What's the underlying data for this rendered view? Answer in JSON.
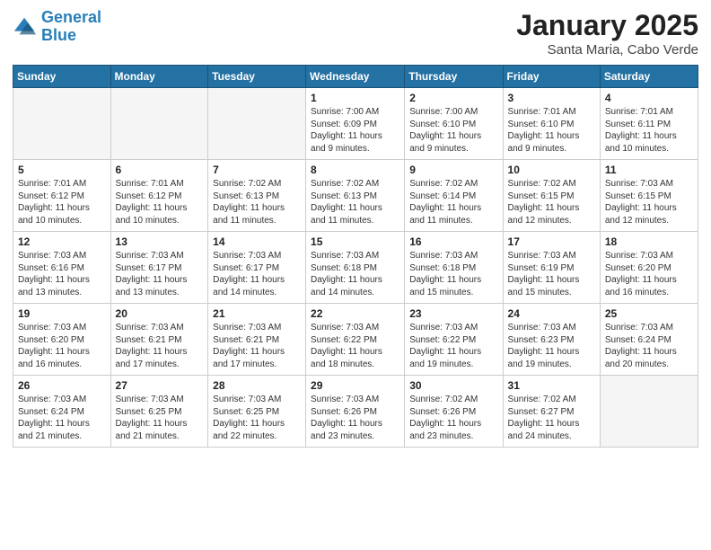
{
  "logo": {
    "line1": "General",
    "line2": "Blue"
  },
  "title": "January 2025",
  "subtitle": "Santa Maria, Cabo Verde",
  "days_header": [
    "Sunday",
    "Monday",
    "Tuesday",
    "Wednesday",
    "Thursday",
    "Friday",
    "Saturday"
  ],
  "weeks": [
    [
      {
        "num": "",
        "info": "",
        "empty": true
      },
      {
        "num": "",
        "info": "",
        "empty": true
      },
      {
        "num": "",
        "info": "",
        "empty": true
      },
      {
        "num": "1",
        "info": "Sunrise: 7:00 AM\nSunset: 6:09 PM\nDaylight: 11 hours\nand 9 minutes.",
        "empty": false
      },
      {
        "num": "2",
        "info": "Sunrise: 7:00 AM\nSunset: 6:10 PM\nDaylight: 11 hours\nand 9 minutes.",
        "empty": false
      },
      {
        "num": "3",
        "info": "Sunrise: 7:01 AM\nSunset: 6:10 PM\nDaylight: 11 hours\nand 9 minutes.",
        "empty": false
      },
      {
        "num": "4",
        "info": "Sunrise: 7:01 AM\nSunset: 6:11 PM\nDaylight: 11 hours\nand 10 minutes.",
        "empty": false
      }
    ],
    [
      {
        "num": "5",
        "info": "Sunrise: 7:01 AM\nSunset: 6:12 PM\nDaylight: 11 hours\nand 10 minutes.",
        "empty": false
      },
      {
        "num": "6",
        "info": "Sunrise: 7:01 AM\nSunset: 6:12 PM\nDaylight: 11 hours\nand 10 minutes.",
        "empty": false
      },
      {
        "num": "7",
        "info": "Sunrise: 7:02 AM\nSunset: 6:13 PM\nDaylight: 11 hours\nand 11 minutes.",
        "empty": false
      },
      {
        "num": "8",
        "info": "Sunrise: 7:02 AM\nSunset: 6:13 PM\nDaylight: 11 hours\nand 11 minutes.",
        "empty": false
      },
      {
        "num": "9",
        "info": "Sunrise: 7:02 AM\nSunset: 6:14 PM\nDaylight: 11 hours\nand 11 minutes.",
        "empty": false
      },
      {
        "num": "10",
        "info": "Sunrise: 7:02 AM\nSunset: 6:15 PM\nDaylight: 11 hours\nand 12 minutes.",
        "empty": false
      },
      {
        "num": "11",
        "info": "Sunrise: 7:03 AM\nSunset: 6:15 PM\nDaylight: 11 hours\nand 12 minutes.",
        "empty": false
      }
    ],
    [
      {
        "num": "12",
        "info": "Sunrise: 7:03 AM\nSunset: 6:16 PM\nDaylight: 11 hours\nand 13 minutes.",
        "empty": false
      },
      {
        "num": "13",
        "info": "Sunrise: 7:03 AM\nSunset: 6:17 PM\nDaylight: 11 hours\nand 13 minutes.",
        "empty": false
      },
      {
        "num": "14",
        "info": "Sunrise: 7:03 AM\nSunset: 6:17 PM\nDaylight: 11 hours\nand 14 minutes.",
        "empty": false
      },
      {
        "num": "15",
        "info": "Sunrise: 7:03 AM\nSunset: 6:18 PM\nDaylight: 11 hours\nand 14 minutes.",
        "empty": false
      },
      {
        "num": "16",
        "info": "Sunrise: 7:03 AM\nSunset: 6:18 PM\nDaylight: 11 hours\nand 15 minutes.",
        "empty": false
      },
      {
        "num": "17",
        "info": "Sunrise: 7:03 AM\nSunset: 6:19 PM\nDaylight: 11 hours\nand 15 minutes.",
        "empty": false
      },
      {
        "num": "18",
        "info": "Sunrise: 7:03 AM\nSunset: 6:20 PM\nDaylight: 11 hours\nand 16 minutes.",
        "empty": false
      }
    ],
    [
      {
        "num": "19",
        "info": "Sunrise: 7:03 AM\nSunset: 6:20 PM\nDaylight: 11 hours\nand 16 minutes.",
        "empty": false
      },
      {
        "num": "20",
        "info": "Sunrise: 7:03 AM\nSunset: 6:21 PM\nDaylight: 11 hours\nand 17 minutes.",
        "empty": false
      },
      {
        "num": "21",
        "info": "Sunrise: 7:03 AM\nSunset: 6:21 PM\nDaylight: 11 hours\nand 17 minutes.",
        "empty": false
      },
      {
        "num": "22",
        "info": "Sunrise: 7:03 AM\nSunset: 6:22 PM\nDaylight: 11 hours\nand 18 minutes.",
        "empty": false
      },
      {
        "num": "23",
        "info": "Sunrise: 7:03 AM\nSunset: 6:22 PM\nDaylight: 11 hours\nand 19 minutes.",
        "empty": false
      },
      {
        "num": "24",
        "info": "Sunrise: 7:03 AM\nSunset: 6:23 PM\nDaylight: 11 hours\nand 19 minutes.",
        "empty": false
      },
      {
        "num": "25",
        "info": "Sunrise: 7:03 AM\nSunset: 6:24 PM\nDaylight: 11 hours\nand 20 minutes.",
        "empty": false
      }
    ],
    [
      {
        "num": "26",
        "info": "Sunrise: 7:03 AM\nSunset: 6:24 PM\nDaylight: 11 hours\nand 21 minutes.",
        "empty": false
      },
      {
        "num": "27",
        "info": "Sunrise: 7:03 AM\nSunset: 6:25 PM\nDaylight: 11 hours\nand 21 minutes.",
        "empty": false
      },
      {
        "num": "28",
        "info": "Sunrise: 7:03 AM\nSunset: 6:25 PM\nDaylight: 11 hours\nand 22 minutes.",
        "empty": false
      },
      {
        "num": "29",
        "info": "Sunrise: 7:03 AM\nSunset: 6:26 PM\nDaylight: 11 hours\nand 23 minutes.",
        "empty": false
      },
      {
        "num": "30",
        "info": "Sunrise: 7:02 AM\nSunset: 6:26 PM\nDaylight: 11 hours\nand 23 minutes.",
        "empty": false
      },
      {
        "num": "31",
        "info": "Sunrise: 7:02 AM\nSunset: 6:27 PM\nDaylight: 11 hours\nand 24 minutes.",
        "empty": false
      },
      {
        "num": "",
        "info": "",
        "empty": true
      }
    ]
  ]
}
